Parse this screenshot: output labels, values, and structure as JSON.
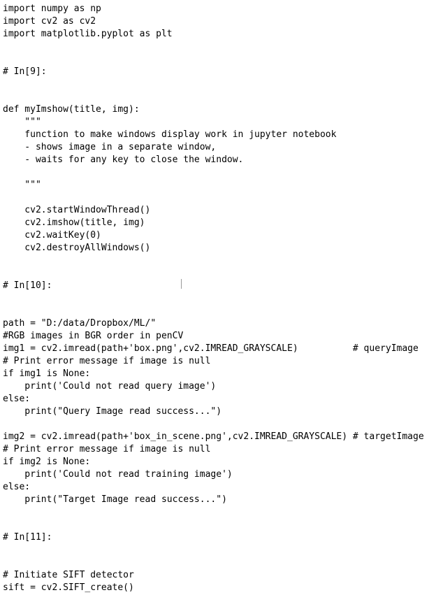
{
  "code": {
    "lines": [
      "import numpy as np",
      "import cv2 as cv2",
      "import matplotlib.pyplot as plt",
      "",
      "",
      "# In[9]:",
      "",
      "",
      "def myImshow(title, img):",
      "    \"\"\"",
      "    function to make windows display work in jupyter notebook",
      "    - shows image in a separate window,",
      "    - waits for any key to close the window.",
      "",
      "    \"\"\"",
      "",
      "    cv2.startWindowThread()",
      "    cv2.imshow(title, img)",
      "    cv2.waitKey(0)",
      "    cv2.destroyAllWindows()",
      "",
      "",
      "# In[10]:",
      "",
      "",
      "path = \"D:/data/Dropbox/ML/\"",
      "#RGB images in BGR order in penCV",
      "img1 = cv2.imread(path+'box.png',cv2.IMREAD_GRAYSCALE)          # queryImage",
      "# Print error message if image is null",
      "if img1 is None:",
      "    print('Could not read query image')",
      "else:",
      "    print(\"Query Image read success...\")",
      "",
      "img2 = cv2.imread(path+'box_in_scene.png',cv2.IMREAD_GRAYSCALE) # targetImage",
      "# Print error message if image is null",
      "if img2 is None:",
      "    print('Could not read training image')",
      "else:",
      "    print(\"Target Image read success...\")",
      "",
      "",
      "# In[11]:",
      "",
      "",
      "# Initiate SIFT detector",
      "sift = cv2.SIFT_create()"
    ]
  }
}
